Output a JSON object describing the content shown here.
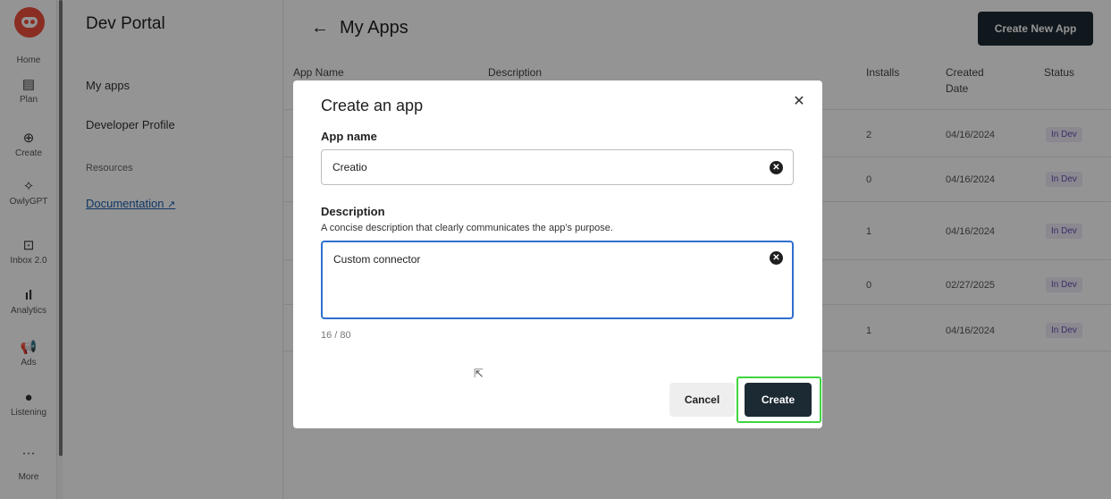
{
  "rail": {
    "logo_icon": "owl-logo-icon",
    "items": [
      {
        "icon": "home-icon",
        "label": "Home"
      },
      {
        "icon": "calendar-icon",
        "label": "Plan"
      },
      {
        "icon": "plus-circle-icon",
        "label": "Create"
      },
      {
        "icon": "sparkle-icon",
        "label": "OwlyGPT"
      },
      {
        "icon": "inbox-icon",
        "label": "Inbox 2.0"
      },
      {
        "icon": "bar-chart-icon",
        "label": "Analytics"
      },
      {
        "icon": "megaphone-icon",
        "label": "Ads"
      },
      {
        "icon": "lightbulb-icon",
        "label": "Listening"
      },
      {
        "icon": "more-dots-icon",
        "label": "More"
      }
    ]
  },
  "sidebar": {
    "title": "Dev Portal",
    "items": [
      "My apps",
      "Developer Profile"
    ],
    "resources_title": "Resources",
    "doc_link": "Documentation"
  },
  "main": {
    "title": "My Apps",
    "create_new_label": "Create New App",
    "columns": {
      "app_name": "App Name",
      "description": "Description",
      "installs": "Installs",
      "created_date": "Created Date",
      "status": "Status"
    },
    "rows": [
      {
        "installs": "2",
        "date": "04/16/2024",
        "status": "In Dev"
      },
      {
        "installs": "0",
        "date": "04/16/2024",
        "status": "In Dev"
      },
      {
        "installs": "1",
        "date": "04/16/2024",
        "status": "In Dev"
      },
      {
        "installs": "0",
        "date": "02/27/2025",
        "status": "In Dev"
      },
      {
        "installs": "1",
        "date": "04/16/2024",
        "status": "In Dev"
      }
    ]
  },
  "modal": {
    "title": "Create an app",
    "app_name_label": "App name",
    "app_name_value": "Creatio",
    "description_label": "Description",
    "description_helper": "A concise description that clearly communicates the app’s purpose.",
    "description_value": "Custom connector",
    "counter": "16 / 80",
    "cancel_label": "Cancel",
    "create_label": "Create"
  },
  "colors": {
    "primary_button": "#1c2a33",
    "focus_border": "#2f6fcf",
    "highlight": "#3ed63e",
    "status_text": "#6b4fb3"
  }
}
